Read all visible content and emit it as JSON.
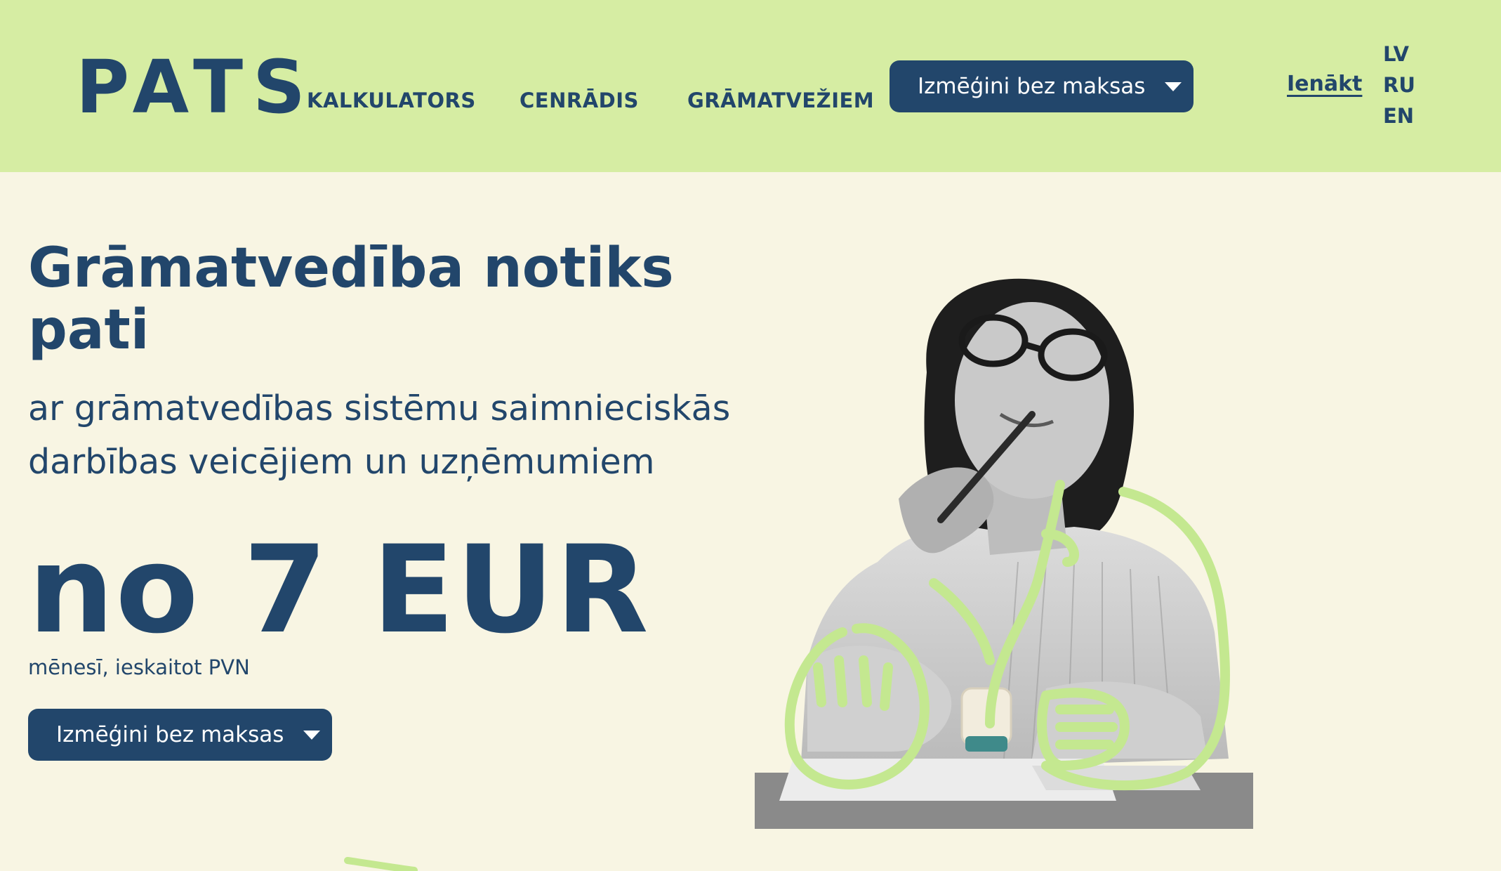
{
  "header": {
    "logo": "PATS",
    "nav": [
      {
        "label": "KALKULATORS"
      },
      {
        "label": "CENRĀDIS"
      },
      {
        "label": "GRĀMATVEŽIEM"
      }
    ],
    "try_button_label": "Izmēģini bez maksas",
    "login_label": "Ienākt",
    "languages": [
      "LV",
      "RU",
      "EN"
    ]
  },
  "hero": {
    "title": "Grāmatvedība notiks pati",
    "subtitle": "ar grāmatvedības sistēmu saimnieciskās darbības veicējiem un uzņēmumiem",
    "price": "no 7 EUR",
    "price_note": "mēnesī, ieskaitot PVN",
    "try_button_label": "Izmēģini bez maksas"
  },
  "colors": {
    "header_bg": "#d6eda3",
    "page_bg": "#f8f5e3",
    "brand_navy": "#22466b",
    "accent_green": "#c4e890"
  },
  "icons": [
    "chevron-down-icon"
  ]
}
